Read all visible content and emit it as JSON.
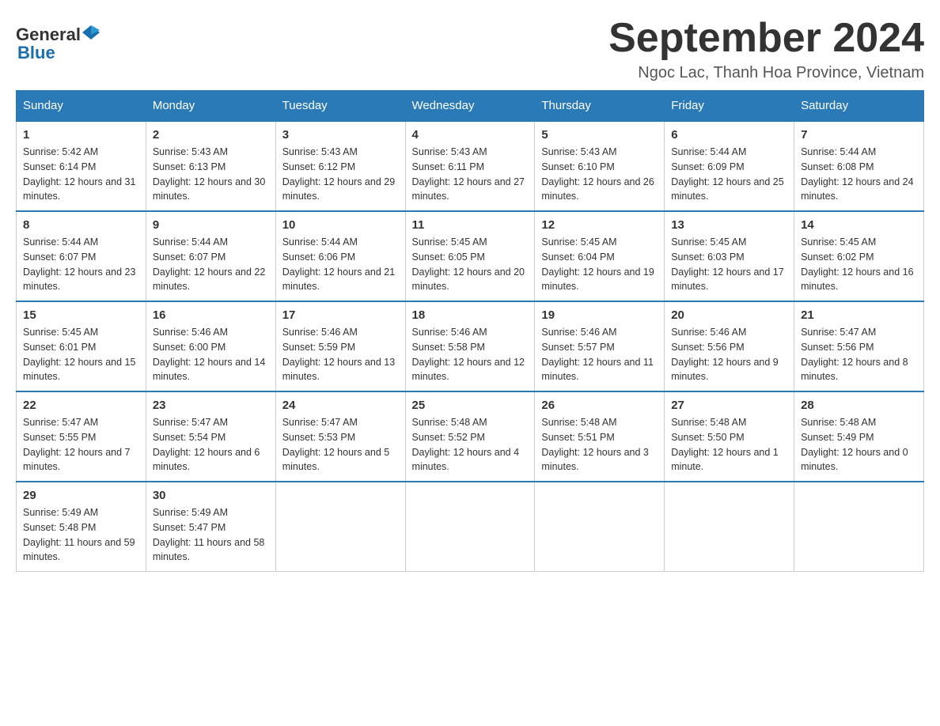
{
  "header": {
    "logo_general": "General",
    "logo_blue": "Blue",
    "month_title": "September 2024",
    "location": "Ngoc Lac, Thanh Hoa Province, Vietnam"
  },
  "days_of_week": [
    "Sunday",
    "Monday",
    "Tuesday",
    "Wednesday",
    "Thursday",
    "Friday",
    "Saturday"
  ],
  "weeks": [
    [
      {
        "day": "1",
        "sunrise": "Sunrise: 5:42 AM",
        "sunset": "Sunset: 6:14 PM",
        "daylight": "Daylight: 12 hours and 31 minutes."
      },
      {
        "day": "2",
        "sunrise": "Sunrise: 5:43 AM",
        "sunset": "Sunset: 6:13 PM",
        "daylight": "Daylight: 12 hours and 30 minutes."
      },
      {
        "day": "3",
        "sunrise": "Sunrise: 5:43 AM",
        "sunset": "Sunset: 6:12 PM",
        "daylight": "Daylight: 12 hours and 29 minutes."
      },
      {
        "day": "4",
        "sunrise": "Sunrise: 5:43 AM",
        "sunset": "Sunset: 6:11 PM",
        "daylight": "Daylight: 12 hours and 27 minutes."
      },
      {
        "day": "5",
        "sunrise": "Sunrise: 5:43 AM",
        "sunset": "Sunset: 6:10 PM",
        "daylight": "Daylight: 12 hours and 26 minutes."
      },
      {
        "day": "6",
        "sunrise": "Sunrise: 5:44 AM",
        "sunset": "Sunset: 6:09 PM",
        "daylight": "Daylight: 12 hours and 25 minutes."
      },
      {
        "day": "7",
        "sunrise": "Sunrise: 5:44 AM",
        "sunset": "Sunset: 6:08 PM",
        "daylight": "Daylight: 12 hours and 24 minutes."
      }
    ],
    [
      {
        "day": "8",
        "sunrise": "Sunrise: 5:44 AM",
        "sunset": "Sunset: 6:07 PM",
        "daylight": "Daylight: 12 hours and 23 minutes."
      },
      {
        "day": "9",
        "sunrise": "Sunrise: 5:44 AM",
        "sunset": "Sunset: 6:07 PM",
        "daylight": "Daylight: 12 hours and 22 minutes."
      },
      {
        "day": "10",
        "sunrise": "Sunrise: 5:44 AM",
        "sunset": "Sunset: 6:06 PM",
        "daylight": "Daylight: 12 hours and 21 minutes."
      },
      {
        "day": "11",
        "sunrise": "Sunrise: 5:45 AM",
        "sunset": "Sunset: 6:05 PM",
        "daylight": "Daylight: 12 hours and 20 minutes."
      },
      {
        "day": "12",
        "sunrise": "Sunrise: 5:45 AM",
        "sunset": "Sunset: 6:04 PM",
        "daylight": "Daylight: 12 hours and 19 minutes."
      },
      {
        "day": "13",
        "sunrise": "Sunrise: 5:45 AM",
        "sunset": "Sunset: 6:03 PM",
        "daylight": "Daylight: 12 hours and 17 minutes."
      },
      {
        "day": "14",
        "sunrise": "Sunrise: 5:45 AM",
        "sunset": "Sunset: 6:02 PM",
        "daylight": "Daylight: 12 hours and 16 minutes."
      }
    ],
    [
      {
        "day": "15",
        "sunrise": "Sunrise: 5:45 AM",
        "sunset": "Sunset: 6:01 PM",
        "daylight": "Daylight: 12 hours and 15 minutes."
      },
      {
        "day": "16",
        "sunrise": "Sunrise: 5:46 AM",
        "sunset": "Sunset: 6:00 PM",
        "daylight": "Daylight: 12 hours and 14 minutes."
      },
      {
        "day": "17",
        "sunrise": "Sunrise: 5:46 AM",
        "sunset": "Sunset: 5:59 PM",
        "daylight": "Daylight: 12 hours and 13 minutes."
      },
      {
        "day": "18",
        "sunrise": "Sunrise: 5:46 AM",
        "sunset": "Sunset: 5:58 PM",
        "daylight": "Daylight: 12 hours and 12 minutes."
      },
      {
        "day": "19",
        "sunrise": "Sunrise: 5:46 AM",
        "sunset": "Sunset: 5:57 PM",
        "daylight": "Daylight: 12 hours and 11 minutes."
      },
      {
        "day": "20",
        "sunrise": "Sunrise: 5:46 AM",
        "sunset": "Sunset: 5:56 PM",
        "daylight": "Daylight: 12 hours and 9 minutes."
      },
      {
        "day": "21",
        "sunrise": "Sunrise: 5:47 AM",
        "sunset": "Sunset: 5:56 PM",
        "daylight": "Daylight: 12 hours and 8 minutes."
      }
    ],
    [
      {
        "day": "22",
        "sunrise": "Sunrise: 5:47 AM",
        "sunset": "Sunset: 5:55 PM",
        "daylight": "Daylight: 12 hours and 7 minutes."
      },
      {
        "day": "23",
        "sunrise": "Sunrise: 5:47 AM",
        "sunset": "Sunset: 5:54 PM",
        "daylight": "Daylight: 12 hours and 6 minutes."
      },
      {
        "day": "24",
        "sunrise": "Sunrise: 5:47 AM",
        "sunset": "Sunset: 5:53 PM",
        "daylight": "Daylight: 12 hours and 5 minutes."
      },
      {
        "day": "25",
        "sunrise": "Sunrise: 5:48 AM",
        "sunset": "Sunset: 5:52 PM",
        "daylight": "Daylight: 12 hours and 4 minutes."
      },
      {
        "day": "26",
        "sunrise": "Sunrise: 5:48 AM",
        "sunset": "Sunset: 5:51 PM",
        "daylight": "Daylight: 12 hours and 3 minutes."
      },
      {
        "day": "27",
        "sunrise": "Sunrise: 5:48 AM",
        "sunset": "Sunset: 5:50 PM",
        "daylight": "Daylight: 12 hours and 1 minute."
      },
      {
        "day": "28",
        "sunrise": "Sunrise: 5:48 AM",
        "sunset": "Sunset: 5:49 PM",
        "daylight": "Daylight: 12 hours and 0 minutes."
      }
    ],
    [
      {
        "day": "29",
        "sunrise": "Sunrise: 5:49 AM",
        "sunset": "Sunset: 5:48 PM",
        "daylight": "Daylight: 11 hours and 59 minutes."
      },
      {
        "day": "30",
        "sunrise": "Sunrise: 5:49 AM",
        "sunset": "Sunset: 5:47 PM",
        "daylight": "Daylight: 11 hours and 58 minutes."
      },
      null,
      null,
      null,
      null,
      null
    ]
  ]
}
